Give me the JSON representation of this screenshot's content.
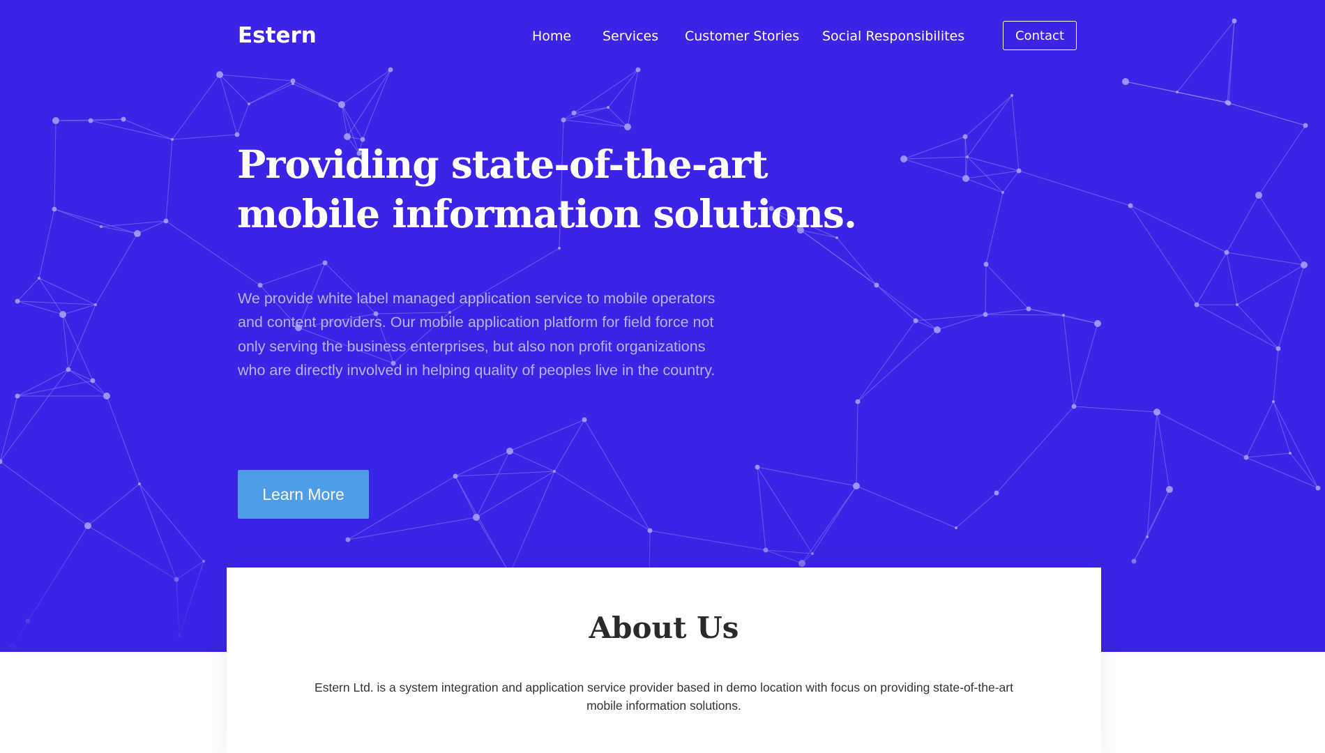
{
  "brand": {
    "logo": "Estern"
  },
  "nav": {
    "items": [
      {
        "label": "Home"
      },
      {
        "label": "Services"
      },
      {
        "label": "Customer Stories"
      },
      {
        "label": "Social Responsibilites"
      }
    ],
    "contact_label": "Contact"
  },
  "hero": {
    "headline": "Providing state-of-the-art mobile information solutions.",
    "lead": "We provide white label managed application service to mobile operators and content providers. Our mobile application platform for field force not only serving the business enterprises, but also non profit organizations who are directly involved in helping quality of peoples live in the country.",
    "cta_label": "Learn More"
  },
  "about": {
    "title": "About Us",
    "text": "Estern Ltd. is a system integration and application service provider based in demo location with focus on providing state-of-the-art mobile information solutions."
  },
  "colors": {
    "hero_background": "#3c24e6",
    "cta_background": "#4f9de6",
    "lead_text": "#b3b6f3",
    "network_line": "#8e86f2",
    "network_dot": "#a9a4f7"
  },
  "decor": {
    "background_pattern": "particle-network"
  }
}
